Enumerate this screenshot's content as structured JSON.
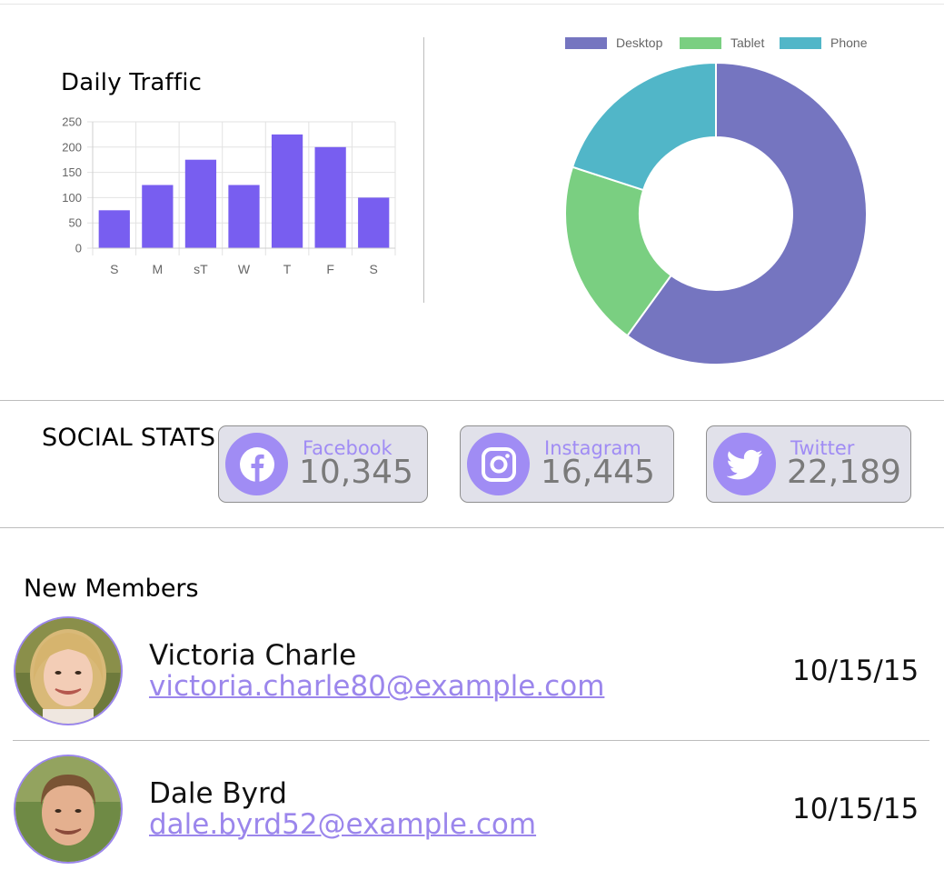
{
  "traffic": {
    "title": "Daily Traffic"
  },
  "chart_data": [
    {
      "type": "bar",
      "title": "Daily Traffic",
      "categories": [
        "S",
        "M",
        "sT",
        "W",
        "T",
        "F",
        "S"
      ],
      "values": [
        75,
        125,
        175,
        125,
        225,
        200,
        100
      ],
      "ylim": [
        0,
        250
      ],
      "yticks": [
        0,
        50,
        100,
        150,
        200,
        250
      ],
      "ytick_labels": [
        "0",
        "50",
        "100",
        "150",
        "200",
        "250"
      ],
      "grid": true,
      "color": "#785ef0"
    },
    {
      "type": "pie",
      "style": "donut",
      "labels": [
        "Desktop",
        "Tablet",
        "Phone"
      ],
      "values": [
        60,
        20,
        20
      ],
      "colors": [
        "#7575c0",
        "#7acf81",
        "#51b6c8"
      ],
      "legend": "top"
    }
  ],
  "social": {
    "title": "SOCIAL STATS",
    "cards": [
      {
        "name": "Facebook",
        "count": "10,345",
        "icon": "facebook-icon"
      },
      {
        "name": "Instagram",
        "count": "16,445",
        "icon": "instagram-icon"
      },
      {
        "name": "Twitter",
        "count": "22,189",
        "icon": "twitter-icon"
      }
    ],
    "accent": "#a08cf4"
  },
  "members": {
    "title": "New Members",
    "list": [
      {
        "name": "Victoria Charle",
        "email": "victoria.charle80@example.com",
        "date": "10/15/15"
      },
      {
        "name": "Dale Byrd",
        "email": "dale.byrd52@example.com",
        "date": "10/15/15"
      }
    ]
  }
}
